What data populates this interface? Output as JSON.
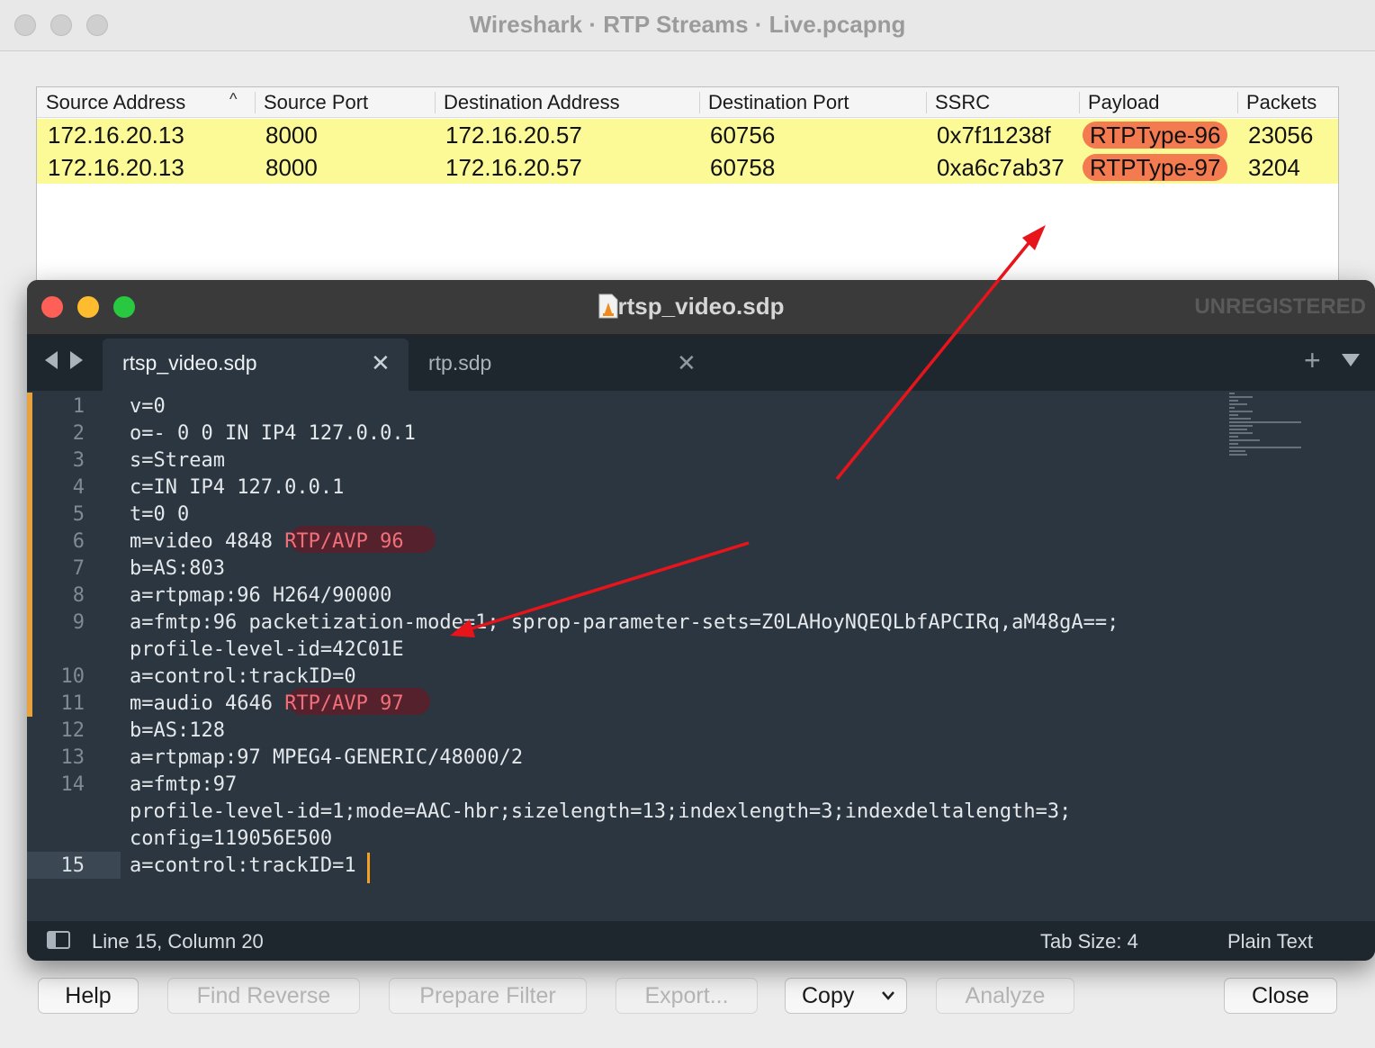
{
  "wireshark": {
    "title": "Wireshark · RTP Streams · Live.pcapng",
    "columns": [
      "Source Address",
      "Source Port",
      "Destination Address",
      "Destination Port",
      "SSRC",
      "Payload",
      "Packets"
    ],
    "sort_indicator": "^",
    "rows": [
      {
        "src": "172.16.20.13",
        "sport": "8000",
        "dst": "172.16.20.57",
        "dport": "60756",
        "ssrc": "0x7f11238f",
        "payload": "RTPType-96",
        "packets": "23056"
      },
      {
        "src": "172.16.20.13",
        "sport": "8000",
        "dst": "172.16.20.57",
        "dport": "60758",
        "ssrc": "0xa6c7ab37",
        "payload": "RTPType-97",
        "packets": "3204"
      }
    ],
    "buttons": {
      "help": "Help",
      "find_reverse": "Find Reverse",
      "prepare_filter": "Prepare Filter",
      "export": "Export...",
      "copy": "Copy",
      "analyze": "Analyze",
      "close": "Close"
    },
    "row_highlight_color": "#fcfa96",
    "payload_highlight_color": "#f47a50"
  },
  "editor": {
    "title": "rtsp_video.sdp",
    "unregistered": "UNREGISTERED",
    "tabs": [
      {
        "label": "rtsp_video.sdp",
        "active": true
      },
      {
        "label": "rtp.sdp",
        "active": false
      }
    ],
    "line_numbers": [
      "1",
      "2",
      "3",
      "4",
      "5",
      "6",
      "7",
      "8",
      "9",
      "10",
      "11",
      "12",
      "13",
      "14",
      "15"
    ],
    "lines": {
      "l1": "v=0",
      "l2": "o=- 0 0 IN IP4 127.0.0.1",
      "l3": "s=Stream",
      "l4": "c=IN IP4 127.0.0.1",
      "l5": "t=0 0",
      "l6a": "m=video 4848 ",
      "l6b": "RTP/AVP 96",
      "l7": "b=AS:803",
      "l8": "a=rtpmap:96 H264/90000",
      "l9a": "a=fmtp:96 packetization-mode=1; sprop-parameter-sets=Z0LAHoyNQEQLbfAPCIRq,aM48gA==;",
      "l9b": "profile-level-id=42C01E",
      "l10": "a=control:trackID=0",
      "l11a": "m=audio 4646 ",
      "l11b": "RTP/AVP 97",
      "l12": "b=AS:128",
      "l13": "a=rtpmap:97 MPEG4-GENERIC/48000/2",
      "l14a": "a=fmtp:97",
      "l14b": "profile-level-id=1;mode=AAC-hbr;sizelength=13;indexlength=3;indexdeltalength=3;",
      "l14c": "config=119056E500",
      "l15": "a=control:trackID=1"
    },
    "status": {
      "position": "Line 15, Column 20",
      "tab_size": "Tab Size: 4",
      "syntax": "Plain Text"
    },
    "accent_color": "#f0707a",
    "arrow_color": "#e8141b"
  }
}
